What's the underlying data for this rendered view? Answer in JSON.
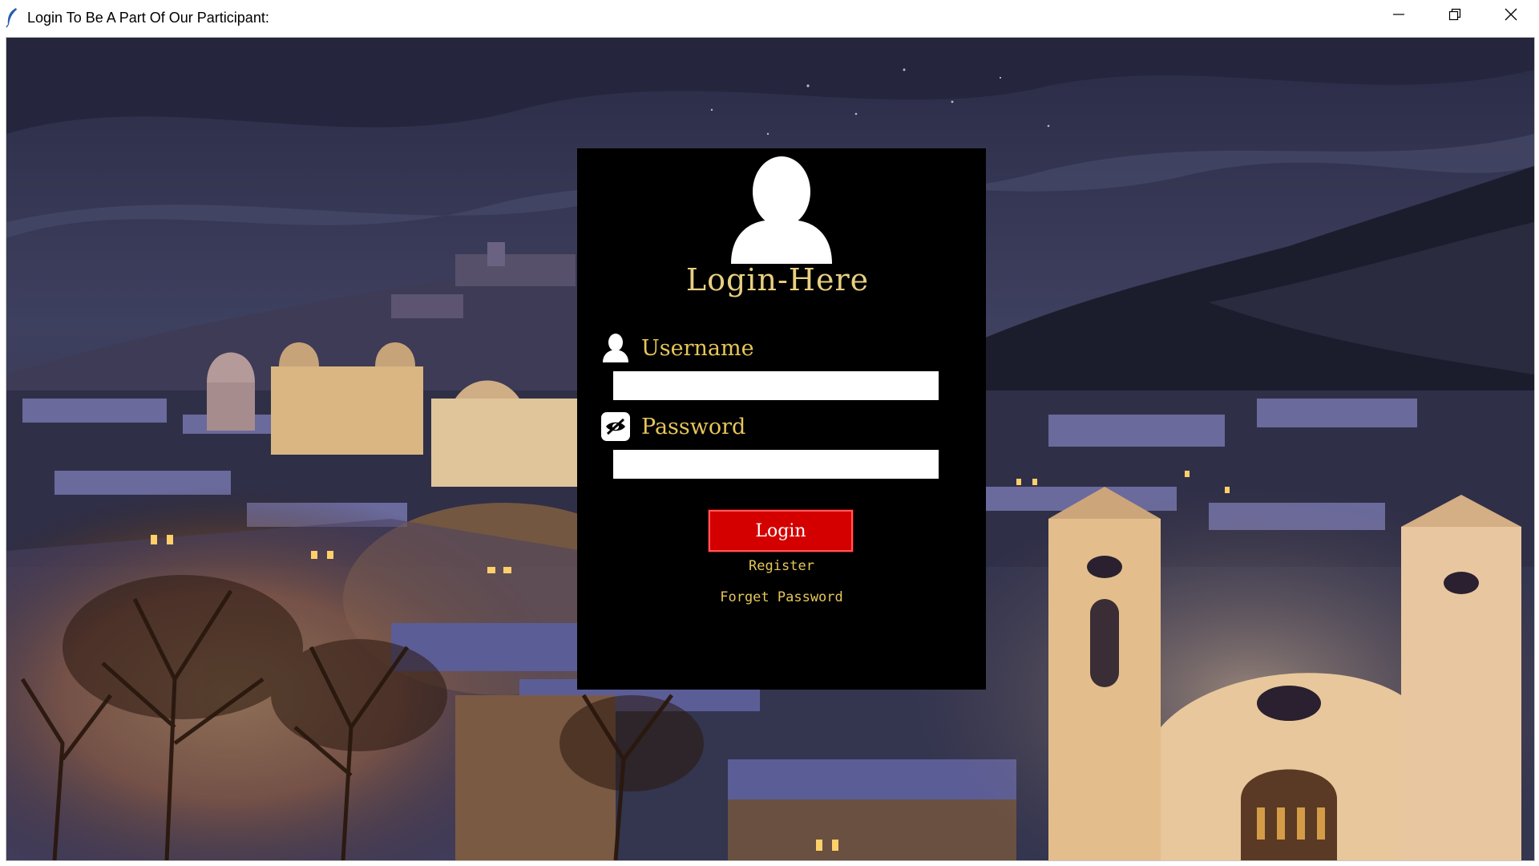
{
  "window": {
    "title": "Login To Be A Part Of Our Participant:",
    "app_icon": "feather-icon",
    "controls": [
      "minimize-icon",
      "restore-icon",
      "close-icon"
    ]
  },
  "login_panel": {
    "title": "Login-Here",
    "avatar_icon": "user-silhouette-icon",
    "username": {
      "label": "Username",
      "icon": "user-icon",
      "value": ""
    },
    "password": {
      "label": "Password",
      "icon": "eye-hidden-icon",
      "value": ""
    },
    "login_button": "Login",
    "register_link": "Register",
    "forgot_link": "Forget Password"
  },
  "colors": {
    "panel_bg": "#000000",
    "label_gold": "#e6c65a",
    "button_red": "#d40000"
  }
}
